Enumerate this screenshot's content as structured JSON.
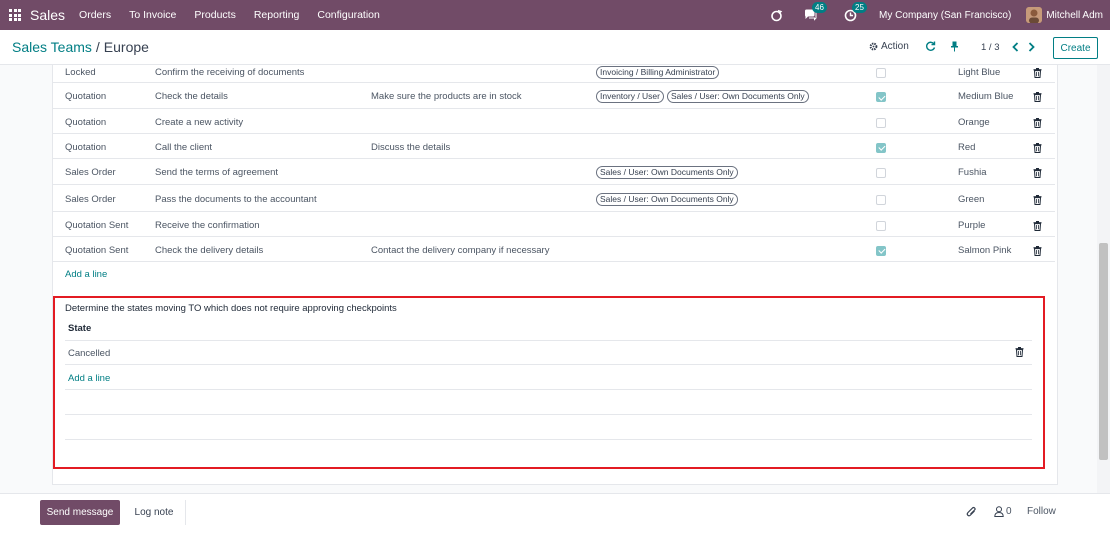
{
  "nav": {
    "brand": "Sales",
    "menu": [
      "Orders",
      "To Invoice",
      "Products",
      "Reporting",
      "Configuration"
    ],
    "messages_count": "46",
    "activities_count": "25",
    "company": "My Company (San Francisco)",
    "user": "Mitchell Adm"
  },
  "control": {
    "breadcrumb_parent": "Sales Teams",
    "breadcrumb_sep": "/",
    "breadcrumb_current": "Europe",
    "action_label": "Action",
    "pager": "1 / 3",
    "create_label": "Create"
  },
  "checkpoints": [
    {
      "stage": "Locked",
      "action": "Confirm the receiving of documents",
      "note": "",
      "groups": [
        "Invoicing / Billing Administrator"
      ],
      "checked": false,
      "color": "Light Blue"
    },
    {
      "stage": "Quotation",
      "action": "Check the details",
      "note": "Make sure the products are in stock",
      "groups": [
        "Inventory / User",
        "Sales / User: Own Documents Only"
      ],
      "checked": true,
      "color": "Medium Blue"
    },
    {
      "stage": "Quotation",
      "action": "Create a new activity",
      "note": "",
      "groups": [],
      "checked": false,
      "color": "Orange"
    },
    {
      "stage": "Quotation",
      "action": "Call the client",
      "note": "Discuss the details",
      "groups": [],
      "checked": true,
      "color": "Red"
    },
    {
      "stage": "Sales Order",
      "action": "Send the terms of agreement",
      "note": "",
      "groups": [
        "Sales / User: Own Documents Only"
      ],
      "checked": false,
      "color": "Fushia"
    },
    {
      "stage": "Sales Order",
      "action": "Pass the documents to the accountant",
      "note": "",
      "groups": [
        "Sales / User: Own Documents Only"
      ],
      "checked": false,
      "color": "Green"
    },
    {
      "stage": "Quotation Sent",
      "action": "Receive the confirmation",
      "note": "",
      "groups": [],
      "checked": false,
      "color": "Purple"
    },
    {
      "stage": "Quotation Sent",
      "action": "Check the delivery details",
      "note": "Contact the delivery company if necessary",
      "groups": [],
      "checked": true,
      "color": "Salmon Pink"
    }
  ],
  "add_line_label": "Add a line",
  "states_section": {
    "title": "Determine the states moving TO which does not require approving checkpoints",
    "header": "State",
    "rows": [
      "Cancelled"
    ],
    "add_line_label": "Add a line"
  },
  "chatter": {
    "send_label": "Send message",
    "log_label": "Log note",
    "followers_count": "0",
    "follow_label": "Follow"
  },
  "colors": {
    "brand": "#714B67",
    "accent": "#017E84",
    "highlight": "#e31b23"
  }
}
